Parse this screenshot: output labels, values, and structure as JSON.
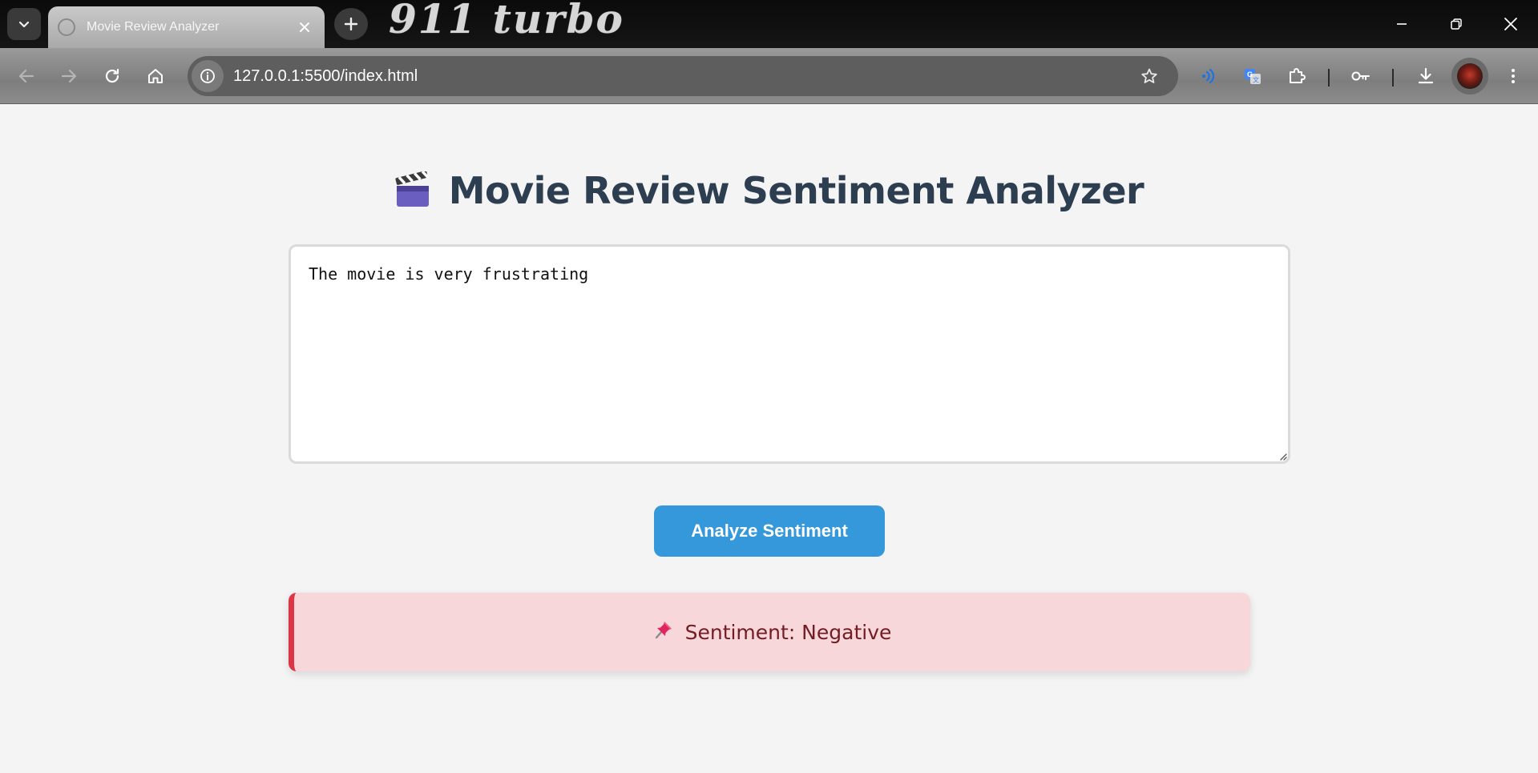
{
  "browser": {
    "tab_title": "Movie Review Analyzer",
    "window_brand": "911 turbo",
    "url": "127.0.0.1:5500/index.html"
  },
  "page": {
    "title": "Movie Review Sentiment Analyzer",
    "review_text": "The movie is very frustrating",
    "analyze_button": "Analyze Sentiment",
    "result_text": "Sentiment: Negative"
  },
  "colors": {
    "title": "#2c3e50",
    "button": "#3498db",
    "result_background": "#f8d7da",
    "result_border": "#dc3545",
    "result_text": "#721c24"
  },
  "icons": {
    "title_icon": "clapperboard-icon",
    "result_icon": "pushpin-icon"
  }
}
